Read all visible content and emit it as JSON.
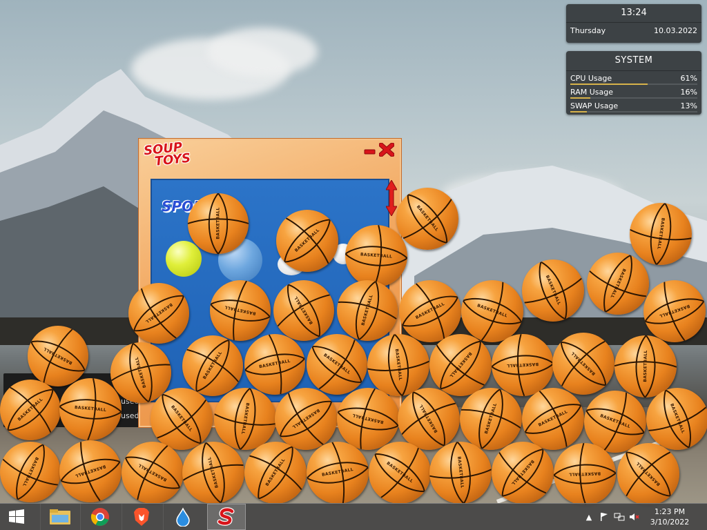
{
  "clock_widget": {
    "time": "13:24",
    "day": "Thursday",
    "date": "10.03.2022"
  },
  "system_widget": {
    "title": "SYSTEM",
    "rows": [
      {
        "label": "CPU Usage",
        "value": "61%",
        "fraction": 0.61
      },
      {
        "label": "RAM Usage",
        "value": "16%",
        "fraction": 0.16
      },
      {
        "label": "SWAP Usage",
        "value": "13%",
        "fraction": 0.13
      }
    ]
  },
  "background_panel": {
    "line1": "used",
    "line2": "used"
  },
  "toy_window": {
    "logo_line1": "SOUP",
    "logo_line2": "TOYS",
    "sport_label": "SPOR",
    "ball_text": "BASKETBALL"
  },
  "taskbar": {
    "apps": [
      "start-button",
      "file-explorer",
      "chrome",
      "brave",
      "raindrop",
      "soup-toys"
    ],
    "clock_time": "1:23 PM",
    "clock_date": "3/10/2022"
  },
  "colors": {
    "ball_orange": "#e8821e",
    "window_orange": "#f2a861",
    "play_blue": "#2c74c8",
    "logo_red": "#d8141a",
    "widget_bg": "#3d4245",
    "bar_gold": "#d8b34a"
  }
}
